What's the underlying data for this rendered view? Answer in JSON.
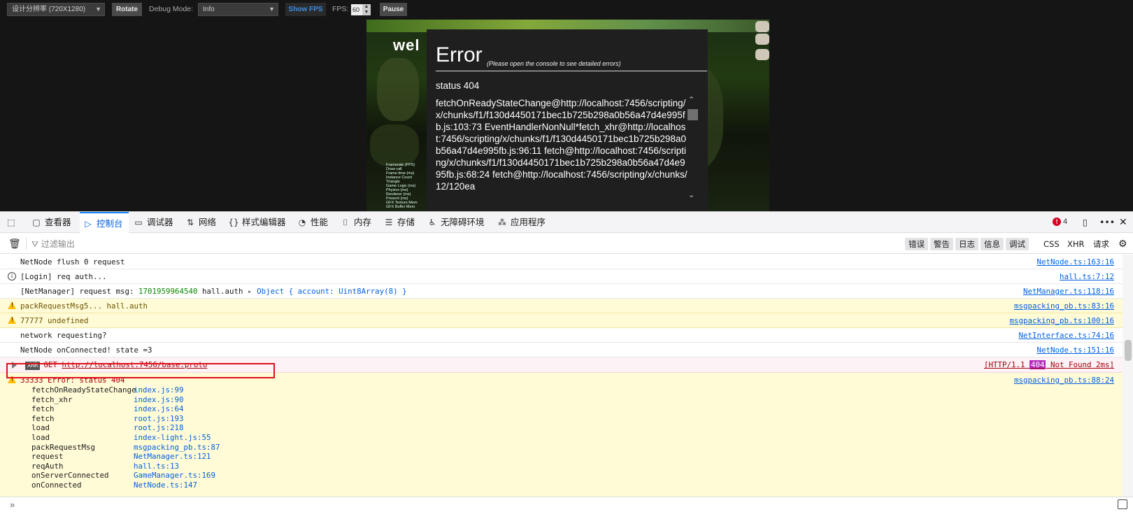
{
  "toolbar": {
    "resolution": "设计分辨率 (720X1280)",
    "rotate": "Rotate",
    "debug_label": "Debug Mode:",
    "debug_value": "Info",
    "show_fps": "Show FPS",
    "fps_label": "FPS:",
    "fps_value": "60",
    "pause": "Pause"
  },
  "game": {
    "welcome": "wel",
    "stats_lines": [
      "Framerate (FPS)",
      "Draw call",
      "Frame time (ms)",
      "Instance Count",
      "Triangle",
      "Game Logic (ms)",
      "Physics (ms)",
      "Renderer (ms)",
      "Present (ms)",
      "GFX Texture Mem",
      "GFX Buffer Mem"
    ]
  },
  "error_dialog": {
    "title": "Error",
    "subtitle": "(Please open the console to see detailed errors)",
    "status": "status 404",
    "stack": "fetchOnReadyStateChange@http://localhost:7456/scripting/x/chunks/f1/f130d4450171bec1b725b298a0b56a47d4e995fb.js:103:73 EventHandlerNonNull*fetch_xhr@http://localhost:7456/scripting/x/chunks/f1/f130d4450171bec1b725b298a0b56a47d4e995fb.js:96:11 fetch@http://localhost:7456/scripting/x/chunks/f1/f130d4450171bec1b725b298a0b56a47d4e995fb.js:68:24 fetch@http://localhost:7456/scripting/x/chunks/12/120ea"
  },
  "devtools": {
    "tabs": [
      {
        "label": "查看器",
        "icon": "inspector-icon"
      },
      {
        "label": "控制台",
        "icon": "console-icon"
      },
      {
        "label": "调试器",
        "icon": "debugger-icon"
      },
      {
        "label": "网络",
        "icon": "network-icon"
      },
      {
        "label": "样式编辑器",
        "icon": "style-editor-icon"
      },
      {
        "label": "性能",
        "icon": "performance-icon"
      },
      {
        "label": "内存",
        "icon": "memory-icon"
      },
      {
        "label": "存储",
        "icon": "storage-icon"
      },
      {
        "label": "无障碍环境",
        "icon": "accessibility-icon"
      },
      {
        "label": "应用程序",
        "icon": "application-icon"
      }
    ],
    "error_count": "4",
    "filter_placeholder": "过滤输出",
    "levels": [
      "错误",
      "警告",
      "日志",
      "信息",
      "调试"
    ],
    "extra_filters": [
      "CSS",
      "XHR",
      "请求"
    ],
    "log": {
      "r0_text": "NetNode flush 0 request",
      "r0_src": "NetNode.ts:163:16",
      "r1_text": "[Login] req auth...",
      "r1_src": "hall.ts:7:12",
      "r2_prefix": "[NetManager] request msg: ",
      "r2_num": "1701959964540",
      "r2_mid": " hall.auth ",
      "r2_obj": "Object { account: Uint8Array(8) }",
      "r2_src": "NetManager.ts:118:16",
      "r3_text": "packRequestMsg5... hall.auth",
      "r3_src": "msgpacking_pb.ts:83:16",
      "r4_text": "77777 undefined",
      "r4_src": "msgpacking_pb.ts:100:16",
      "r5_text": "network requesting?",
      "r5_src": "NetInterface.ts:74:16",
      "r6_text": "NetNode onConnected! state =3",
      "r6_src": "NetNode.ts:151:16",
      "r7_badge": "XHR",
      "r7_method": "GET",
      "r7_url": "http://localhost:7456/base.proto",
      "r7_status_pre": "[HTTP/1.1 ",
      "r7_code": "404",
      "r7_status_post": " Not Found 2ms]",
      "r8_text": "33333 Error: status 404",
      "r8_src": "msgpacking_pb.ts:88:24",
      "stack": [
        {
          "fn": "fetchOnReadyStateChange",
          "loc": "index.js:99"
        },
        {
          "fn": "fetch_xhr",
          "loc": "index.js:90"
        },
        {
          "fn": "fetch",
          "loc": "index.js:64"
        },
        {
          "fn": "fetch",
          "loc": "root.js:193"
        },
        {
          "fn": "load",
          "loc": "root.js:218"
        },
        {
          "fn": "load",
          "loc": "index-light.js:55"
        },
        {
          "fn": "packRequestMsg",
          "loc": "msgpacking_pb.ts:87"
        },
        {
          "fn": "request",
          "loc": "NetManager.ts:121"
        },
        {
          "fn": "reqAuth",
          "loc": "hall.ts:13"
        },
        {
          "fn": "onServerConnected",
          "loc": "GameManager.ts:169"
        },
        {
          "fn": "onConnected",
          "loc": "NetNode.ts:147"
        }
      ]
    },
    "prompt": "»"
  }
}
